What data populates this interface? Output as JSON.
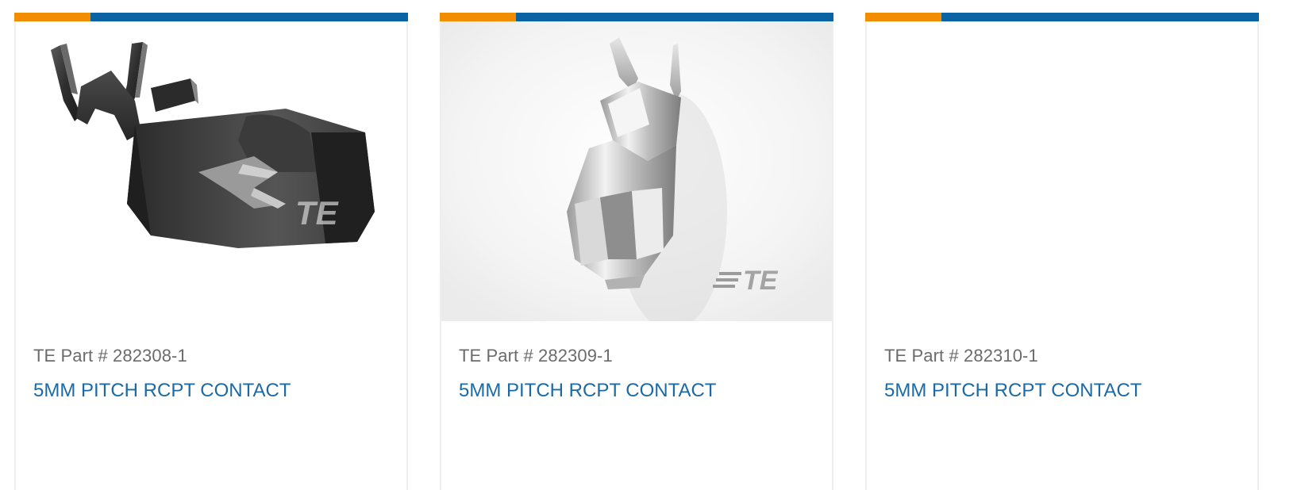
{
  "colors": {
    "accent_orange": "#f28d00",
    "accent_blue": "#0a64a4",
    "title_blue": "#1b6aa5",
    "part_gray": "#6b6b6b",
    "card_border": "#eeeeee"
  },
  "products": [
    {
      "part_number": "TE Part # 282308-1",
      "title": "5MM PITCH RCPT CONTACT",
      "image_icon": "dark-receptacle-contact-image",
      "watermark": "TE"
    },
    {
      "part_number": "TE Part # 282309-1",
      "title": "5MM PITCH RCPT CONTACT",
      "image_icon": "silver-receptacle-contact-image",
      "watermark": "TE"
    },
    {
      "part_number": "TE Part # 282310-1",
      "title": "5MM PITCH RCPT CONTACT",
      "image_icon": "blank-product-image"
    }
  ]
}
